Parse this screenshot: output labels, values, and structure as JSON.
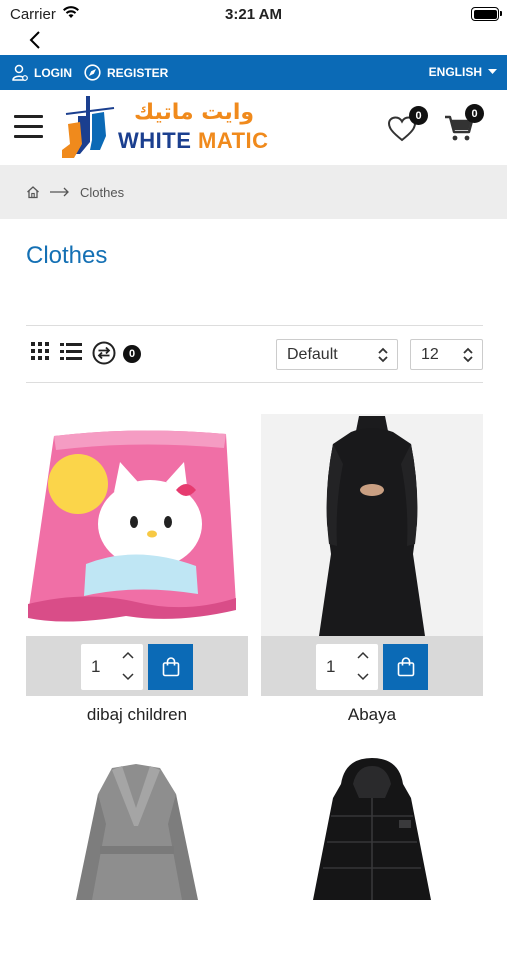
{
  "status": {
    "carrier": "Carrier",
    "time": "3:21 AM"
  },
  "topbar": {
    "login": "LOGIN",
    "register": "REGISTER",
    "language": "ENGLISH"
  },
  "header": {
    "logo_arabic": "وايت ماتيك",
    "logo_white": "WHITE",
    "logo_matic": "MATIC",
    "wishlist_count": "0",
    "cart_count": "0"
  },
  "breadcrumb": {
    "current": "Clothes"
  },
  "page": {
    "title": "Clothes"
  },
  "toolbar": {
    "compare_count": "0",
    "sort_value": "Default",
    "per_page_value": "12"
  },
  "products": [
    {
      "name": "dibaj children",
      "qty": "1"
    },
    {
      "name": "Abaya",
      "qty": "1"
    },
    {
      "name": "",
      "qty": ""
    },
    {
      "name": "",
      "qty": ""
    }
  ],
  "colors": {
    "brand_blue": "#0b6ab6",
    "title_blue": "#1470b4",
    "logo_orange": "#f08a1c",
    "logo_navy": "#1b3f8f"
  }
}
